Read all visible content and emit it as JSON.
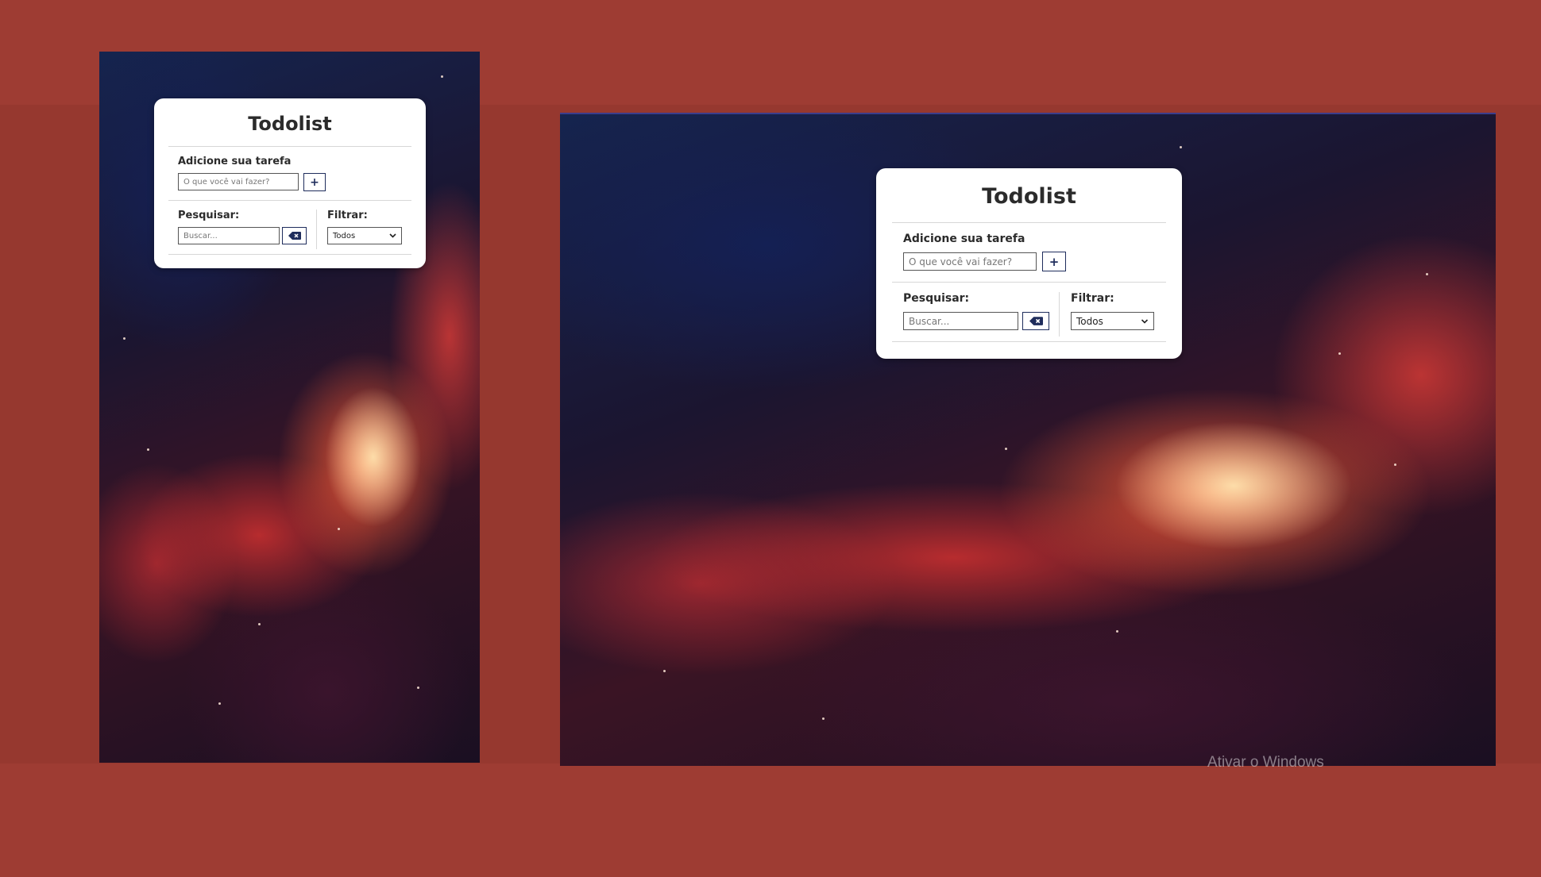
{
  "todo_app": {
    "title": "Todolist",
    "add_section": {
      "label": "Adicione sua tarefa",
      "input_placeholder": "O que você vai fazer?",
      "add_button_label": "+"
    },
    "search_section": {
      "label": "Pesquisar:",
      "input_placeholder": "Buscar...",
      "erase_button_icon": "backspace-icon"
    },
    "filter_section": {
      "label": "Filtrar:",
      "selected_option": "Todos"
    }
  },
  "os_watermark": "Ativar o Windows",
  "colors": {
    "outer_background": "#9e3c33",
    "card_background": "#ffffff",
    "button_accent": "#1f2d5c"
  }
}
